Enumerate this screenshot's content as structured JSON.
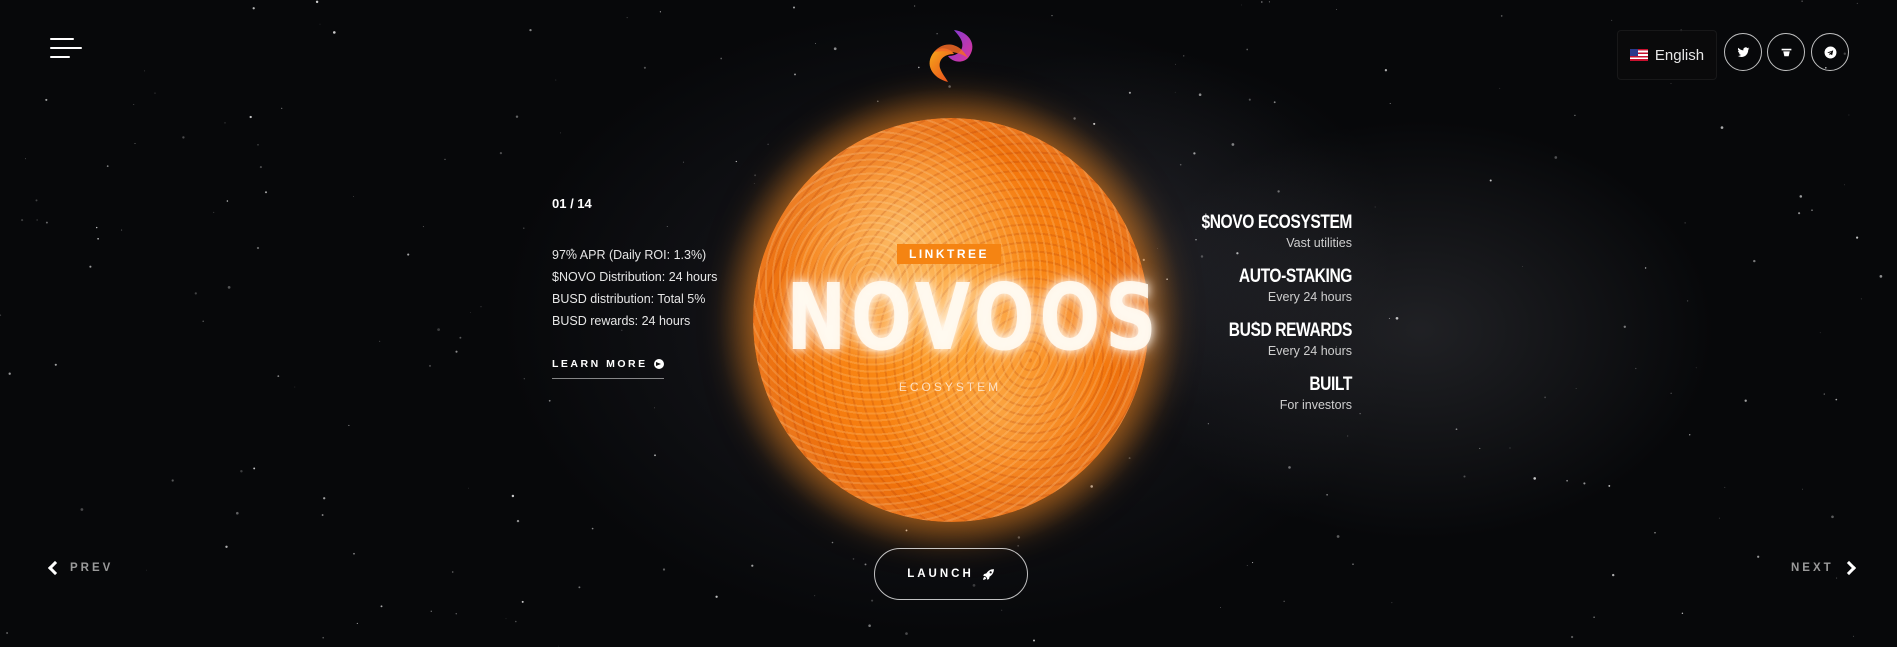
{
  "header": {
    "language": {
      "selected": "English",
      "flag_icon": "us-flag-icon"
    },
    "social_icons": [
      "twitter-icon",
      "linktree-icon",
      "telegram-icon"
    ]
  },
  "slide": {
    "counter": "01 / 14",
    "items": [
      "97% APR (Daily ROI: 1.3%)",
      "$NOVO Distribution: 24 hours",
      "BUSD distribution: Total 5%",
      "BUSD rewards: 24 hours"
    ],
    "learn_more": "LEARN MORE"
  },
  "center": {
    "tag": "LINKTREE",
    "title": "NOVOOS",
    "subtitle": "ECOSYSTEM"
  },
  "features": [
    {
      "title": "$NOVO ECOSYSTEM",
      "desc": "Vast utilities"
    },
    {
      "title": "AUTO-STAKING",
      "desc": "Every 24 hours"
    },
    {
      "title": "BUSD REWARDS",
      "desc": "Every 24 hours"
    },
    {
      "title": "BUILT",
      "desc": "For investors"
    }
  ],
  "nav": {
    "prev": "PREV",
    "next": "NEXT",
    "launch": "LAUNCH"
  },
  "colors": {
    "accent": "#f58412",
    "background": "#07080a"
  }
}
